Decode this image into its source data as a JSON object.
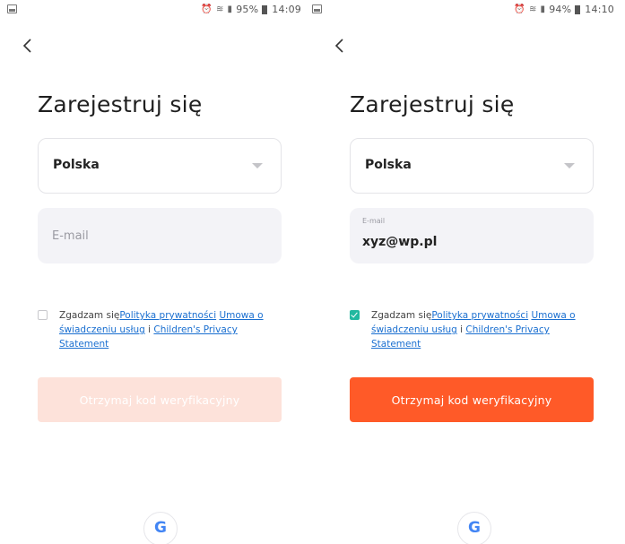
{
  "colors": {
    "accent": "#ff5a28",
    "accent_disabled": "#fde2da",
    "link": "#1a6fd0",
    "checkbox_checked": "#22b8a0",
    "google_blue": "#4285f4"
  },
  "screens": [
    {
      "status_bar": {
        "left_icon": "gallery-notification-icon",
        "icons": [
          "alarm-icon",
          "wifi-icon",
          "signal-icon"
        ],
        "battery": "95%",
        "time": "14:09"
      },
      "back_icon": "chevron-left-icon",
      "title": "Zarejestruj się",
      "country": {
        "value": "Polska",
        "caret_icon": "caret-down-icon"
      },
      "email": {
        "placeholder": "E-mail",
        "label": "",
        "value": ""
      },
      "consent": {
        "checked": false,
        "prefix": "Zgadzam się",
        "privacy_policy": "Polityka prywatności",
        "terms": "Umowa o świadczeniu usług",
        "and": " i ",
        "childrens_privacy": "Children's Privacy Statement"
      },
      "submit": {
        "label": "Otrzymaj kod weryfikacyjny",
        "enabled": false
      },
      "google_login": {
        "icon": "google-icon",
        "glyph": "G"
      }
    },
    {
      "status_bar": {
        "left_icon": "gallery-notification-icon",
        "icons": [
          "alarm-icon",
          "wifi-icon",
          "signal-icon"
        ],
        "battery": "94%",
        "time": "14:10"
      },
      "back_icon": "chevron-left-icon",
      "title": "Zarejestruj się",
      "country": {
        "value": "Polska",
        "caret_icon": "caret-down-icon"
      },
      "email": {
        "placeholder": "",
        "label": "E-mail",
        "value": "xyz@wp.pl"
      },
      "consent": {
        "checked": true,
        "prefix": "Zgadzam się",
        "privacy_policy": "Polityka prywatności",
        "terms": "Umowa o świadczeniu usług",
        "and": " i ",
        "childrens_privacy": "Children's Privacy Statement"
      },
      "submit": {
        "label": "Otrzymaj kod weryfikacyjny",
        "enabled": true
      },
      "google_login": {
        "icon": "google-icon",
        "glyph": "G"
      }
    }
  ]
}
